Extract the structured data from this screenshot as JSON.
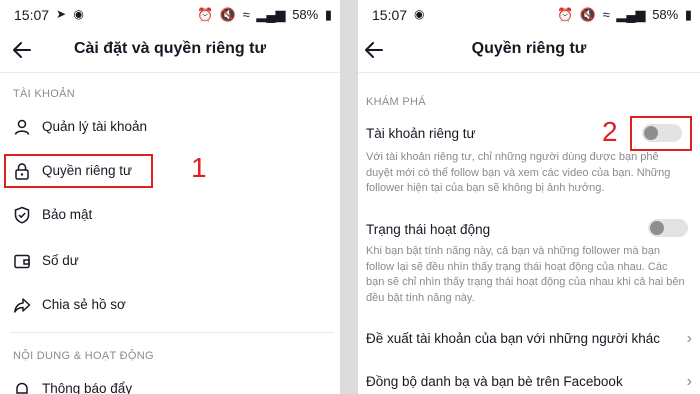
{
  "status_bar": {
    "time": "15:07",
    "battery": "58%",
    "left_icons": [
      "telegram-icon",
      "messenger-icon"
    ],
    "right_icons": [
      "alarm-icon",
      "mute-icon",
      "wifi-icon",
      "signal-icon",
      "battery-icon"
    ]
  },
  "left": {
    "title": "Cài đặt và quyền riêng tư",
    "section_account": "TÀI KHOẢN",
    "items": [
      {
        "label": "Quản lý tài khoản",
        "icon": "person-icon"
      },
      {
        "label": "Quyền riêng tư",
        "icon": "lock-icon"
      },
      {
        "label": "Bảo mật",
        "icon": "shield-icon"
      },
      {
        "label": "Số dư",
        "icon": "wallet-icon"
      },
      {
        "label": "Chia sẻ hồ sơ",
        "icon": "share-icon"
      }
    ],
    "section_content": "NỘI DUNG & HOẠT ĐỘNG",
    "items2": [
      {
        "label": "Thông báo đẩy",
        "icon": "bell-icon"
      }
    ],
    "callout_number": "1"
  },
  "right": {
    "title": "Quyền riêng tư",
    "section_discover": "KHÁM PHÁ",
    "private_account": {
      "label": "Tài khoản riêng tư",
      "desc": "Với tài khoản riêng tư, chỉ những người dùng được bạn phê duyệt mới có thể follow bạn và xem các video của bạn. Những follower hiện tại của bạn sẽ không bị ảnh hưởng.",
      "enabled": false
    },
    "activity_status": {
      "label": "Trạng thái hoạt động",
      "desc": "Khi bạn bật tính năng này, cả bạn và những follower mà bạn follow lại sẽ đều nhìn thấy trạng thái hoạt động của nhau. Các bạn sẽ chỉ nhìn thấy trạng thái hoạt động của nhau khi cả hai bên đều bật tính năng này.",
      "enabled": false
    },
    "links": [
      "Đề xuất tài khoản của bạn với những người khác",
      "Đồng bộ danh bạ và bạn bè trên Facebook"
    ],
    "callout_number": "2"
  },
  "colors": {
    "accent_red": "#e02020",
    "muted_text": "#8a8b91",
    "divider": "#dcdcdc"
  }
}
